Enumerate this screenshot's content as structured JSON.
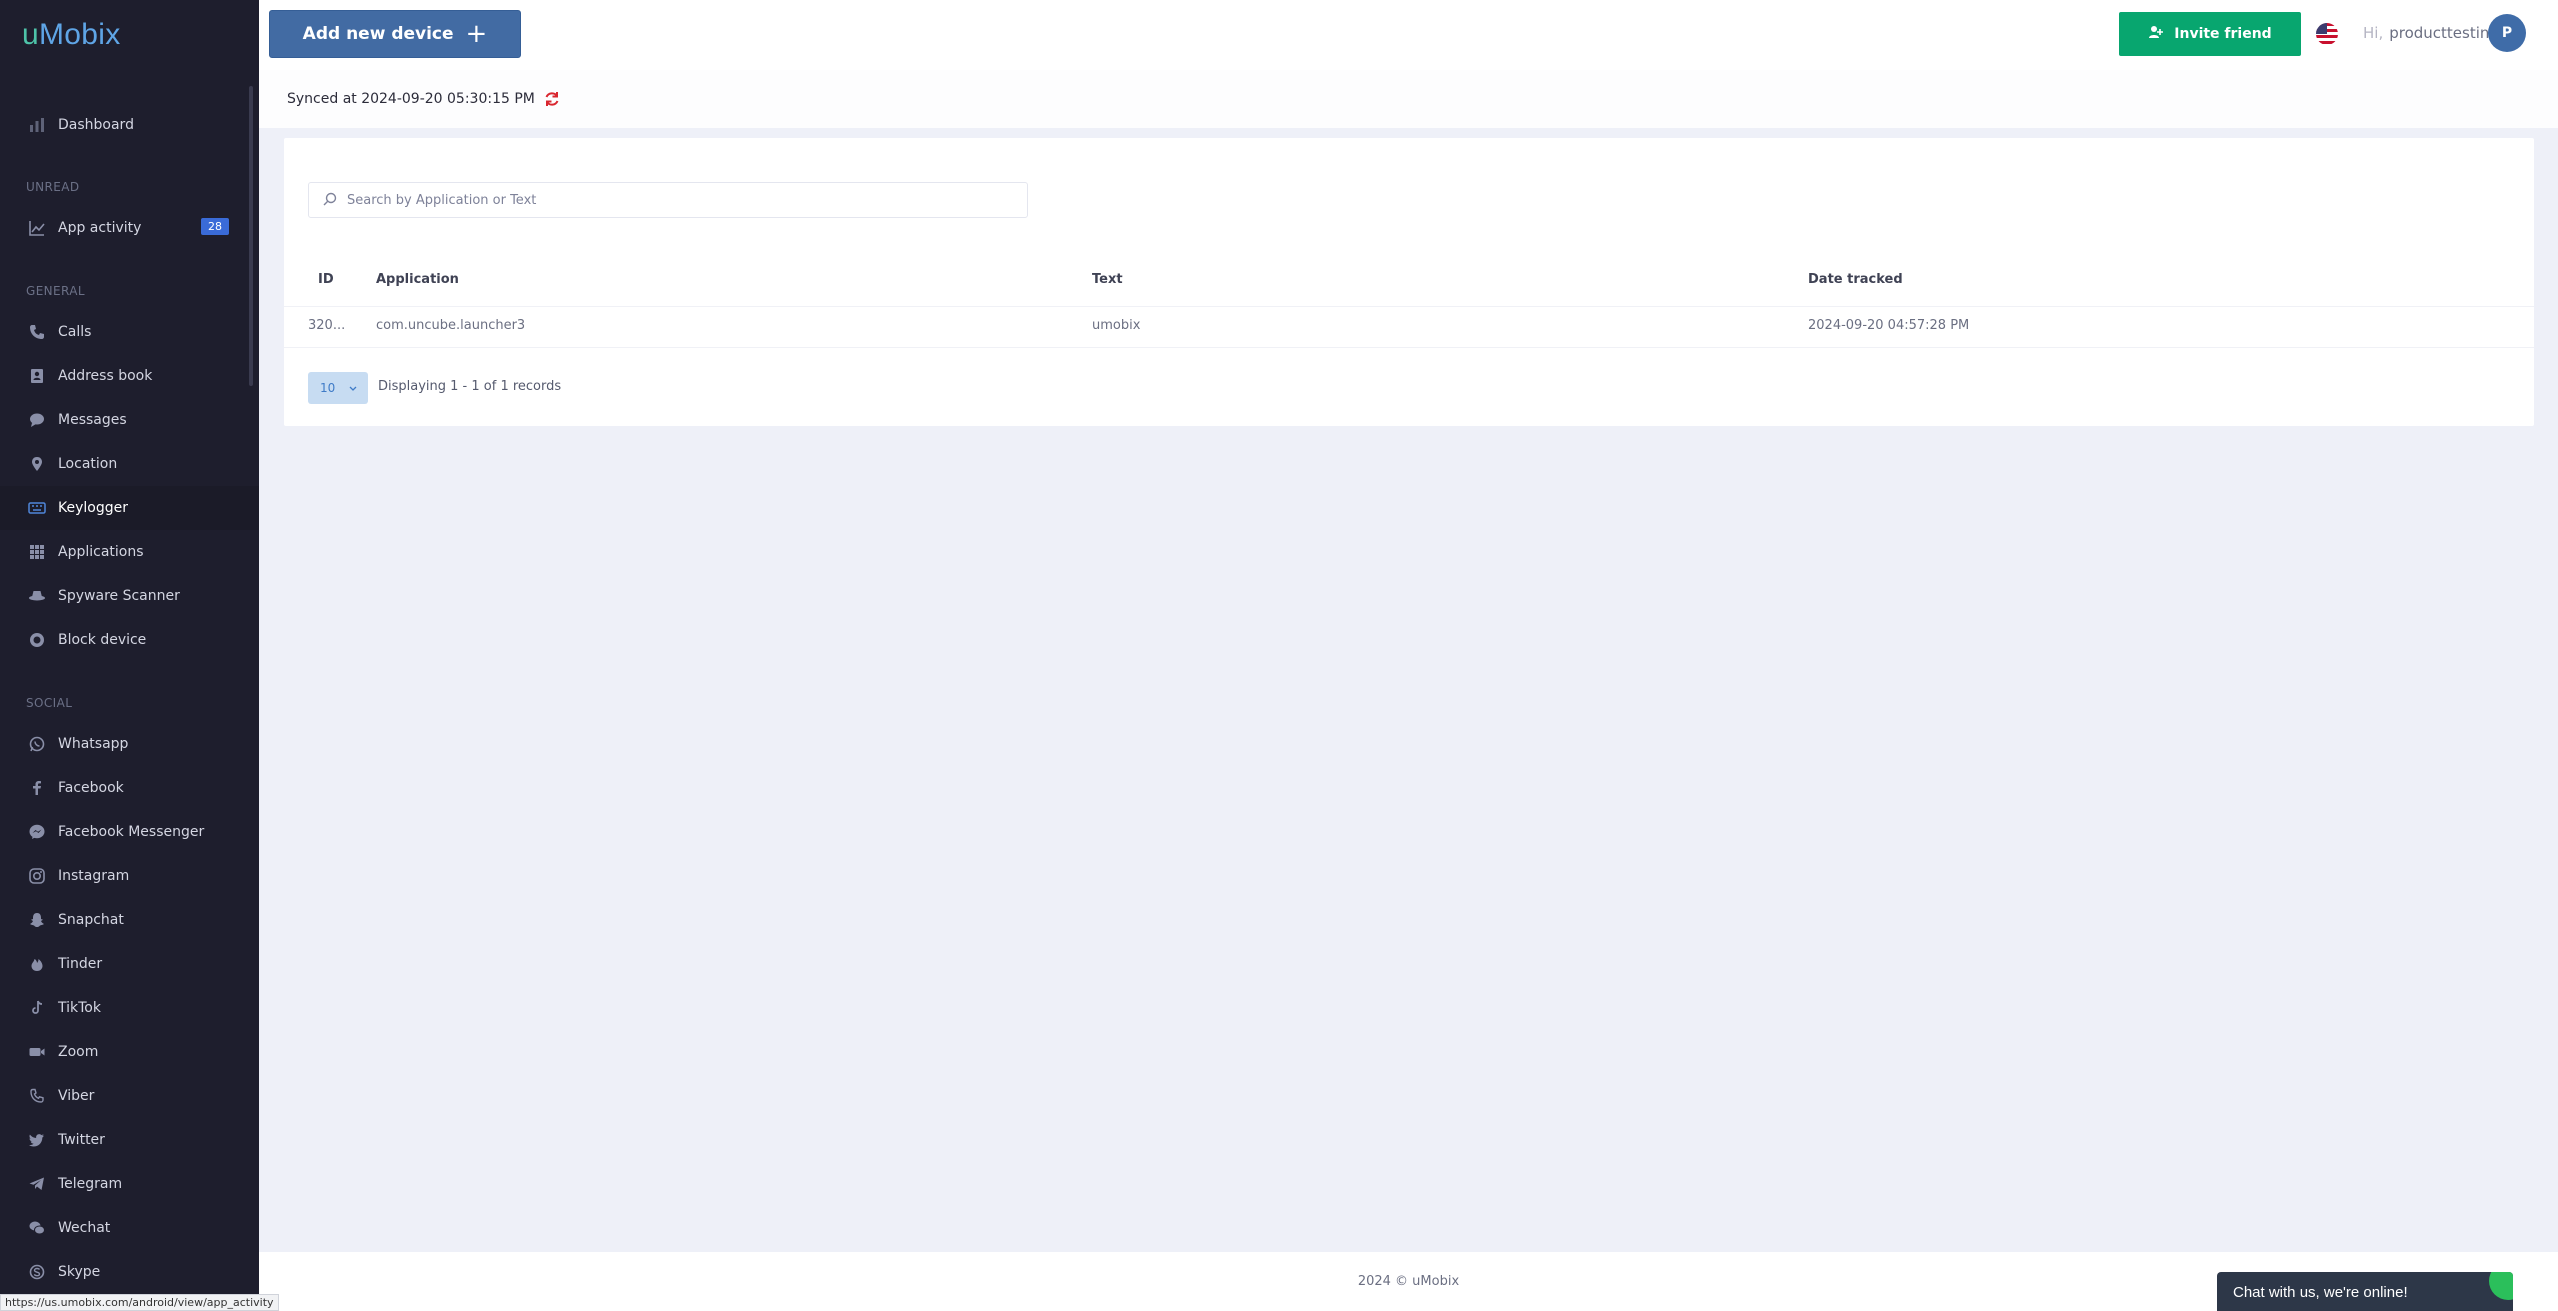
{
  "app": {
    "logo_u": "u",
    "logo_rest": "Mobix"
  },
  "sidebar": {
    "dashboard": "Dashboard",
    "sections": {
      "unread": "UNREAD",
      "general": "GENERAL",
      "social": "SOCIAL"
    },
    "unread_items": [
      {
        "label": "App activity",
        "badge": "28",
        "icon": "bar-chart-icon"
      }
    ],
    "general_items": [
      {
        "label": "Calls",
        "icon": "phone-icon"
      },
      {
        "label": "Address book",
        "icon": "contact-book-icon"
      },
      {
        "label": "Messages",
        "icon": "chat-bubble-icon"
      },
      {
        "label": "Location",
        "icon": "map-pin-icon"
      },
      {
        "label": "Keylogger",
        "icon": "keyboard-icon",
        "active": true
      },
      {
        "label": "Applications",
        "icon": "grid-icon"
      },
      {
        "label": "Spyware Scanner",
        "icon": "spy-hat-icon"
      },
      {
        "label": "Block device",
        "icon": "block-icon"
      }
    ],
    "social_items": [
      {
        "label": "Whatsapp",
        "icon": "whatsapp-icon"
      },
      {
        "label": "Facebook",
        "icon": "facebook-icon"
      },
      {
        "label": "Facebook Messenger",
        "icon": "messenger-icon"
      },
      {
        "label": "Instagram",
        "icon": "instagram-icon"
      },
      {
        "label": "Snapchat",
        "icon": "snapchat-icon"
      },
      {
        "label": "Tinder",
        "icon": "tinder-icon"
      },
      {
        "label": "TikTok",
        "icon": "tiktok-icon"
      },
      {
        "label": "Zoom",
        "icon": "zoom-icon"
      },
      {
        "label": "Viber",
        "icon": "viber-icon"
      },
      {
        "label": "Twitter",
        "icon": "twitter-icon"
      },
      {
        "label": "Telegram",
        "icon": "telegram-icon"
      },
      {
        "label": "Wechat",
        "icon": "wechat-icon"
      },
      {
        "label": "Skype",
        "icon": "skype-icon"
      }
    ]
  },
  "header": {
    "add_device": "Add new device",
    "invite": "Invite friend",
    "hi": "Hi,",
    "username": "producttesting",
    "avatar_letter": "P"
  },
  "sync": {
    "text": "Synced at 2024-09-20 05:30:15 PM"
  },
  "search": {
    "placeholder": "Search by Application or Text",
    "value": ""
  },
  "table": {
    "columns": [
      "ID",
      "Application",
      "Text",
      "Date tracked"
    ],
    "rows": [
      {
        "id": "320...",
        "application": "com.uncube.launcher3",
        "text": "umobix",
        "date": "2024-09-20 04:57:28 PM"
      }
    ]
  },
  "pagination": {
    "page_size": "10",
    "info": "Displaying 1 - 1 of 1 records"
  },
  "footer": {
    "text": "2024 © uMobix"
  },
  "chat": {
    "text": "Chat with us, we're online!"
  },
  "status_url": "https://us.umobix.com/android/view/app_activity",
  "colors": {
    "sidebar_bg": "#1e1e2d",
    "primary": "#426ba3",
    "success": "#08a66f",
    "badge": "#3a6bd8"
  }
}
